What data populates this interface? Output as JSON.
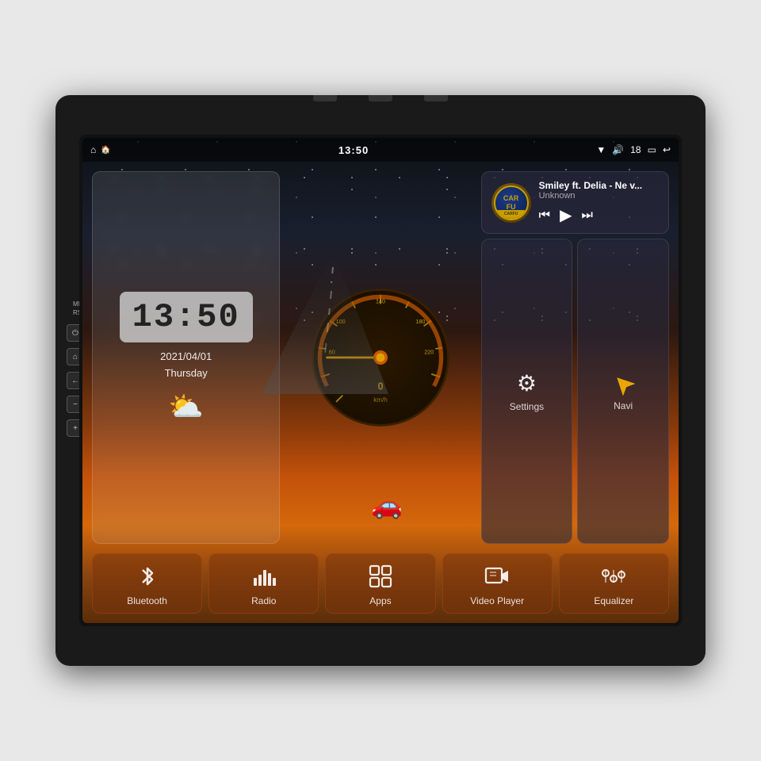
{
  "device": {
    "title": "Car Android Head Unit"
  },
  "status_bar": {
    "home_icon": "⌂",
    "home2_icon": "⌂",
    "time": "13:50",
    "wifi_icon": "▼",
    "volume_icon": "◁",
    "volume_level": "18",
    "battery_icon": "▭",
    "back_icon": "↩"
  },
  "clock": {
    "time": "13:50",
    "date": "2021/04/01",
    "day": "Thursday"
  },
  "music": {
    "title": "Smiley ft. Delia - Ne v...",
    "artist": "Unknown",
    "album_brand": "CARFU",
    "prev_icon": "⏮",
    "play_icon": "▶",
    "next_icon": "⏭"
  },
  "actions": {
    "settings": {
      "label": "Settings",
      "icon": "⚙"
    },
    "navi": {
      "label": "Navi",
      "icon": "▷"
    }
  },
  "bottom_buttons": [
    {
      "id": "bluetooth",
      "label": "Bluetooth",
      "icon": "bluetooth"
    },
    {
      "id": "radio",
      "label": "Radio",
      "icon": "radio"
    },
    {
      "id": "apps",
      "label": "Apps",
      "icon": "apps"
    },
    {
      "id": "video-player",
      "label": "Video Player",
      "icon": "video"
    },
    {
      "id": "equalizer",
      "label": "Equalizer",
      "icon": "equalizer"
    }
  ],
  "hw_buttons": [
    {
      "id": "power",
      "icon": "⏻"
    },
    {
      "id": "home",
      "icon": "⌂"
    },
    {
      "id": "back",
      "icon": "←"
    },
    {
      "id": "vol-down",
      "icon": "−"
    },
    {
      "id": "vol-up",
      "icon": "+"
    }
  ],
  "labels": {
    "mic": "MIC",
    "rst": "RST"
  }
}
